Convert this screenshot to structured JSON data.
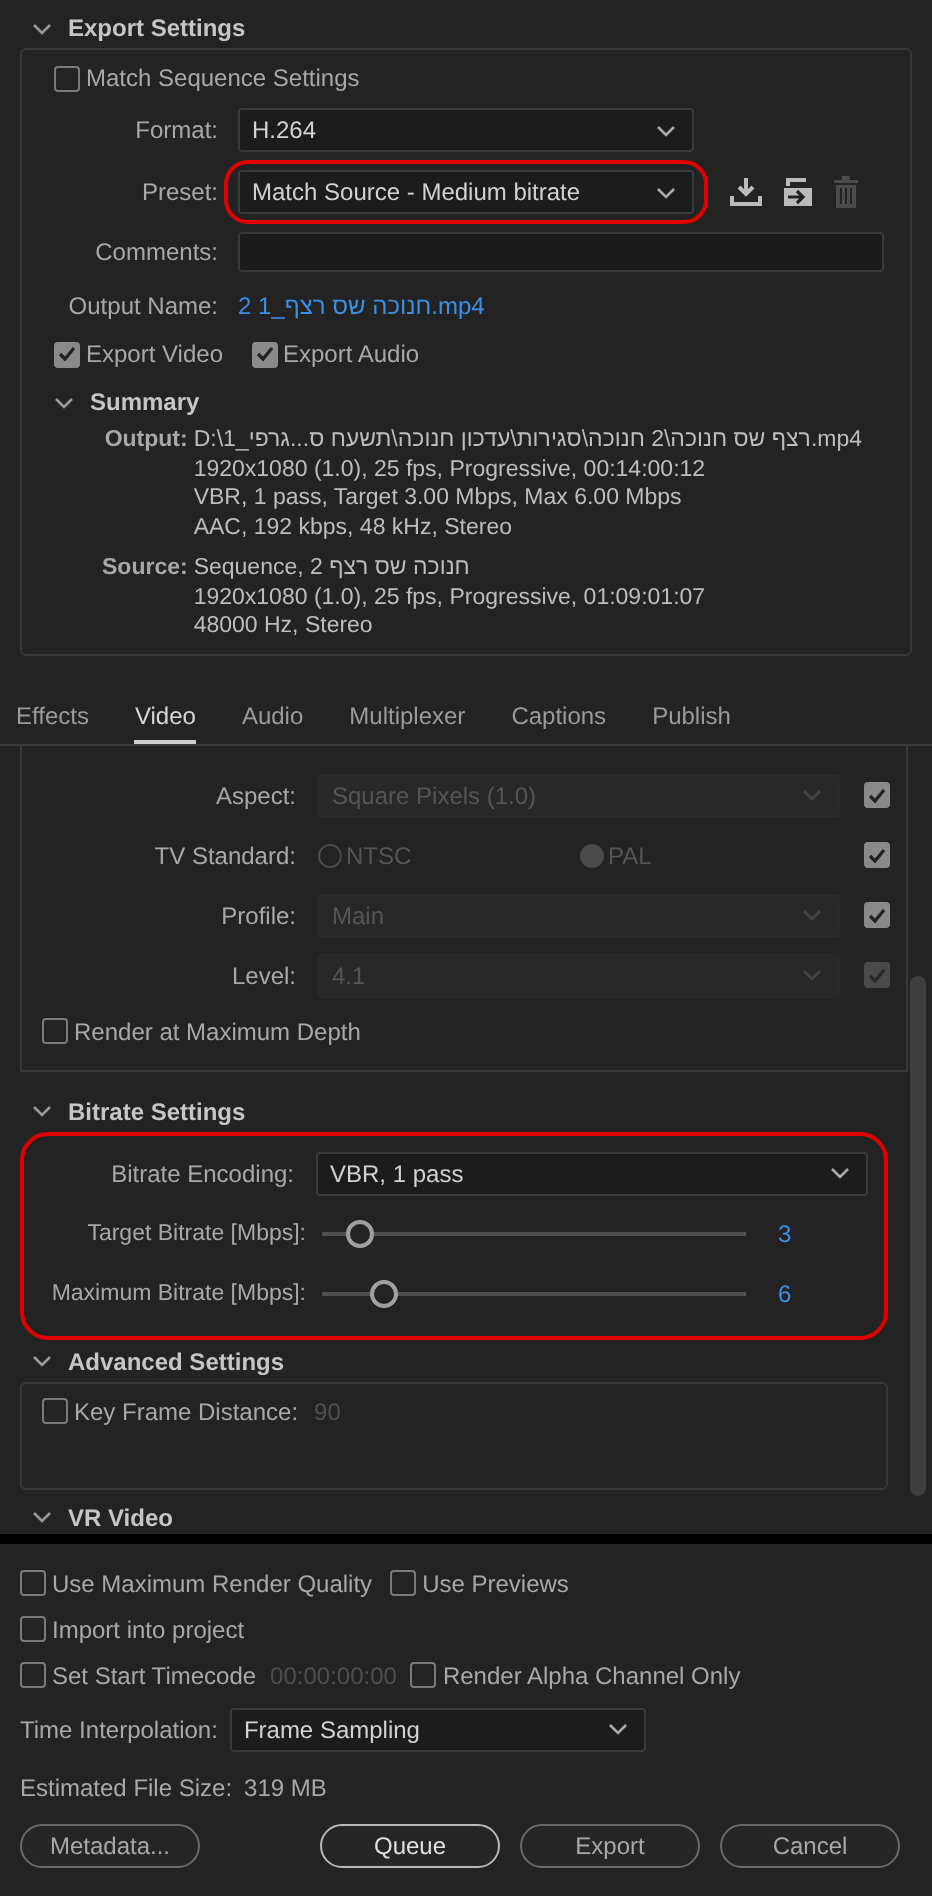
{
  "export_settings": {
    "title": "Export Settings",
    "expanded": true,
    "match_sequence": {
      "label": "Match Sequence Settings",
      "checked": false
    },
    "format": {
      "label": "Format:",
      "value": "H.264"
    },
    "preset": {
      "label": "Preset:",
      "value": "Match Source - Medium bitrate",
      "highlighted": true
    },
    "comments": {
      "label": "Comments:"
    },
    "output_name": {
      "label": "Output Name:",
      "value": "2 1_חנוכה שס רצף.mp4"
    },
    "export_video": {
      "label": "Export Video",
      "checked": true
    },
    "export_audio": {
      "label": "Export Audio",
      "checked": true
    },
    "summary": {
      "title": "Summary",
      "expanded": true,
      "output": {
        "label": "Output:",
        "lines": [
          "D:\\1_רצף שס חנוכה\\2 חנוכה\\סגירות\\עדכון  חנוכה\\תשעח  ס...גרפי.mp4",
          "1920x1080 (1.0), 25 fps, Progressive, 00:14:00:12",
          "VBR, 1 pass, Target 3.00 Mbps, Max 6.00 Mbps",
          "AAC, 192 kbps, 48 kHz, Stereo"
        ]
      },
      "source": {
        "label": "Source:",
        "lines": [
          "Sequence, 2 חנוכה שס רצף",
          "1920x1080 (1.0), 25 fps, Progressive, 01:09:01:07",
          "48000 Hz, Stereo"
        ]
      }
    }
  },
  "tabs": [
    {
      "label": "Effects",
      "selected": false
    },
    {
      "label": "Video",
      "selected": true
    },
    {
      "label": "Audio",
      "selected": false
    },
    {
      "label": "Multiplexer",
      "selected": false
    },
    {
      "label": "Captions",
      "selected": false
    },
    {
      "label": "Publish",
      "selected": false
    }
  ],
  "video": {
    "rows": [
      {
        "kind": "select",
        "label": "Aspect:",
        "value": "Square Pixels (1.0)",
        "disabled": true,
        "checked": true,
        "check_disabled": false
      },
      {
        "kind": "radio",
        "label": "TV Standard:",
        "options": [
          {
            "label": "NTSC",
            "selected": false
          },
          {
            "label": "PAL",
            "selected": true
          }
        ],
        "disabled": true,
        "checked": true,
        "check_disabled": false
      },
      {
        "kind": "select",
        "label": "Profile:",
        "value": "Main",
        "disabled": true,
        "checked": true,
        "check_disabled": false
      },
      {
        "kind": "select",
        "label": "Level:",
        "value": "4.1",
        "disabled": true,
        "checked": true,
        "check_disabled": true
      }
    ],
    "render_max_depth": {
      "label": "Render at Maximum Depth",
      "checked": false
    },
    "bitrate": {
      "title": "Bitrate Settings",
      "expanded": true,
      "highlighted": true,
      "encoding": {
        "label": "Bitrate Encoding:",
        "value": "VBR, 1 pass"
      },
      "sliders": [
        {
          "label": "Target Bitrate [Mbps]:",
          "level": 0.06,
          "reading": "3"
        },
        {
          "label": "Maximum Bitrate [Mbps]:",
          "level": 0.12,
          "reading": "6"
        }
      ]
    },
    "advanced": {
      "title": "Advanced Settings",
      "expanded": true,
      "key_frame": {
        "label": "Key Frame Distance:",
        "checked": false,
        "value": "90"
      }
    },
    "vr": {
      "title": "VR Video",
      "expanded": true
    }
  },
  "options": [
    {
      "label": "Use Maximum Render Quality",
      "checked": false
    },
    {
      "label": "Use Previews",
      "checked": false
    },
    {
      "label": "Import into project",
      "checked": false
    },
    {
      "label": "Set Start Timecode",
      "checked": false,
      "value": "00:00:00:00"
    },
    {
      "label": "Render Alpha Channel Only",
      "checked": false
    }
  ],
  "time_interpolation": {
    "label": "Time Interpolation:",
    "value": "Frame Sampling"
  },
  "estimated_size": {
    "label": "Estimated File Size:",
    "value": "319 MB"
  },
  "buttons": [
    {
      "label": "Metadata...",
      "default": false
    },
    {
      "label": "Queue",
      "default": true
    },
    {
      "label": "Export",
      "default": false
    },
    {
      "label": "Cancel",
      "default": false
    }
  ]
}
